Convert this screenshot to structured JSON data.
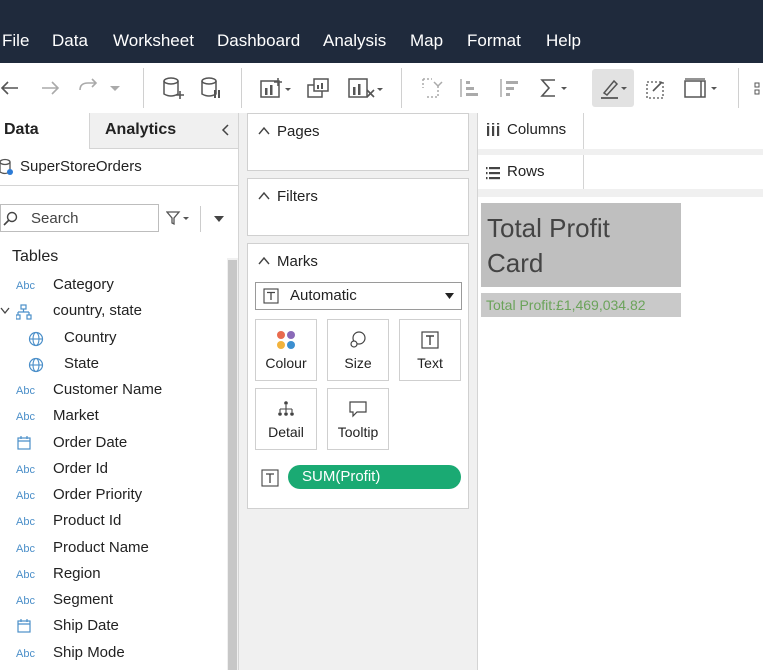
{
  "menu": [
    "File",
    "Data",
    "Worksheet",
    "Dashboard",
    "Analysis",
    "Map",
    "Format",
    "Help"
  ],
  "left_pane": {
    "tab_data": "Data",
    "tab_analytics": "Analytics",
    "collapse_icon": "chevron-left-icon",
    "datasource": "SuperStoreOrders",
    "search_placeholder": "Search",
    "tables_heading": "Tables",
    "fields": [
      {
        "type": "Abc",
        "label": "Category"
      },
      {
        "type": "hierarchy",
        "label": "country, state"
      },
      {
        "type": "globe",
        "label": "Country"
      },
      {
        "type": "globe",
        "label": "State"
      },
      {
        "type": "Abc",
        "label": "Customer Name"
      },
      {
        "type": "Abc",
        "label": "Market"
      },
      {
        "type": "date",
        "label": "Order Date"
      },
      {
        "type": "Abc",
        "label": "Order Id"
      },
      {
        "type": "Abc",
        "label": "Order Priority"
      },
      {
        "type": "Abc",
        "label": "Product Id"
      },
      {
        "type": "Abc",
        "label": "Product Name"
      },
      {
        "type": "Abc",
        "label": "Region"
      },
      {
        "type": "Abc",
        "label": "Segment"
      },
      {
        "type": "date",
        "label": "Ship Date"
      },
      {
        "type": "Abc",
        "label": "Ship Mode"
      }
    ]
  },
  "shelves": {
    "pages": "Pages",
    "filters": "Filters",
    "marks": "Marks",
    "mark_type": "Automatic",
    "mark_buttons": {
      "colour": "Colour",
      "size": "Size",
      "text": "Text",
      "detail": "Detail",
      "tooltip": "Tooltip"
    },
    "pill": "SUM(Profit)"
  },
  "view": {
    "columns": "Columns",
    "rows": "Rows",
    "title_line1": "Total Profit",
    "title_line2": "Card",
    "profit_text": "Total Profit:£1,469,034.82"
  },
  "colors": {
    "menubar_bg": "#1f2a3c",
    "pill_green": "#1aaa73",
    "abc_blue": "#4b8fc9",
    "title_bg": "#bfbfbf",
    "profit_text": "#6ba35a"
  }
}
